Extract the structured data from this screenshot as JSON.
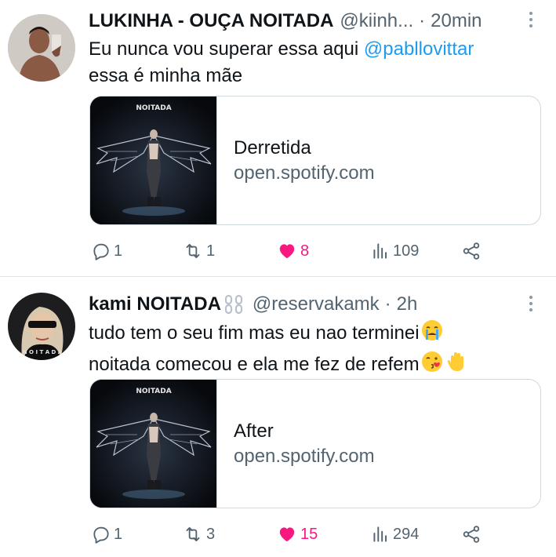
{
  "tweets": [
    {
      "author_name": "LUKINHA - OUÇA NOITADA",
      "author_handle": "@kiinh...",
      "separator": "·",
      "time": "20min",
      "text_line1_prefix": "Eu nunca vou superar essa aqui ",
      "mention": "@pabllovittar",
      "text_line2": "essa é minha mãe",
      "card": {
        "cover_text": "NOITADA",
        "title": "Derretida",
        "domain": "open.spotify.com"
      },
      "actions": {
        "replies": "1",
        "retweets": "1",
        "likes": "8",
        "views": "109"
      }
    },
    {
      "author_name": "kami NOITADA",
      "author_handle": "@reservakamk",
      "separator": "·",
      "time": "2h",
      "text_line1": "tudo tem o seu fim mas eu nao terminei",
      "text_line2": "noitada comecou e ela me fez de refem",
      "card": {
        "cover_text": "NOITADA",
        "title": "After",
        "domain": "open.spotify.com"
      },
      "actions": {
        "replies": "1",
        "retweets": "3",
        "likes": "15",
        "views": "294"
      }
    }
  ],
  "colors": {
    "accent": "#1d9bf0",
    "like": "#f91880",
    "secondary_text": "#536471",
    "border": "#cfd9de"
  },
  "icons": [
    "reply-icon",
    "retweet-icon",
    "heart-icon",
    "views-icon",
    "share-icon",
    "more-icon",
    "chain-icon",
    "crying-emoji",
    "kiss-emoji",
    "wave-emoji"
  ]
}
